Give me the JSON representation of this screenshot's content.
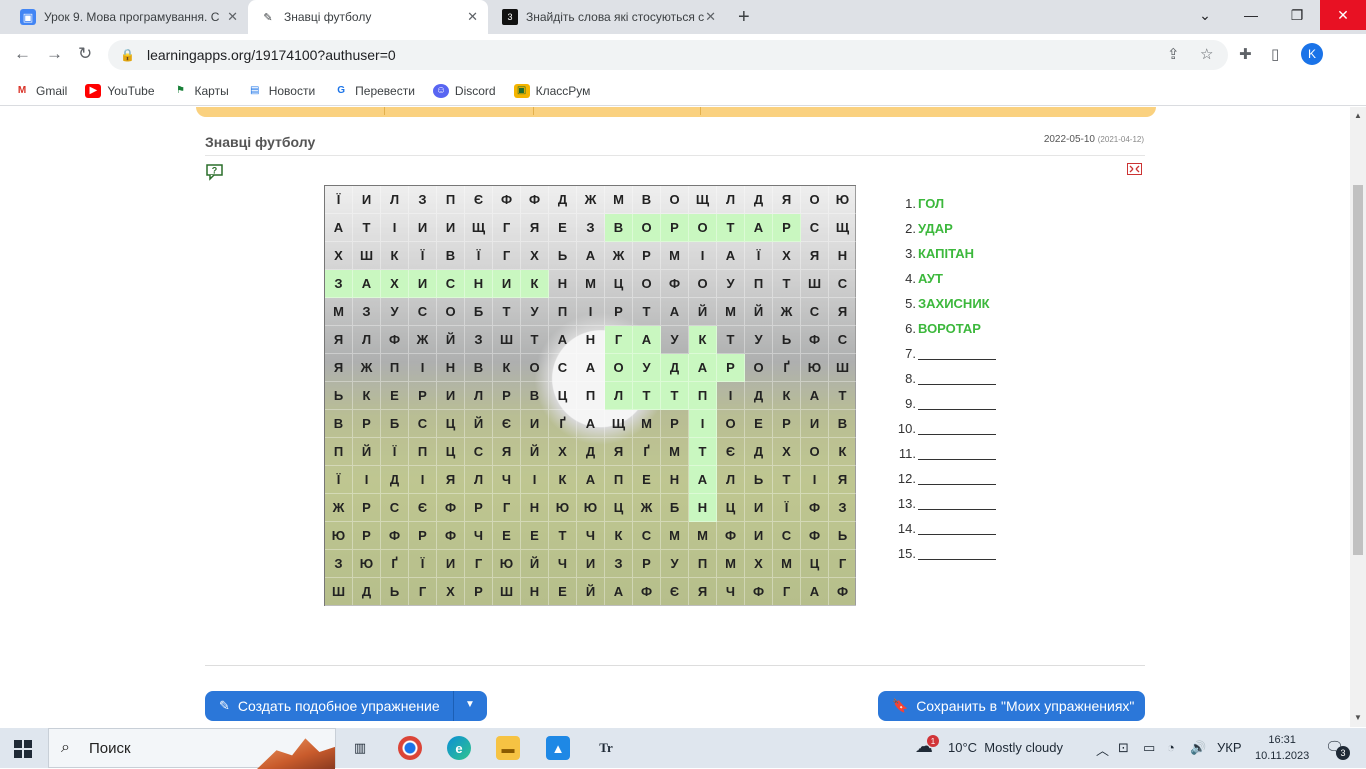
{
  "browser": {
    "tabs": [
      {
        "title": "Урок 9. Мова програмування. С",
        "active": false
      },
      {
        "title": "Знавці футболу",
        "active": true
      },
      {
        "title": "Знайдіть слова які стосуються с",
        "active": false
      }
    ],
    "url": "learningapps.org/19174100?authuser=0",
    "profile_initial": "K",
    "bookmarks": [
      "Gmail",
      "YouTube",
      "Карты",
      "Новости",
      "Перевести",
      "Discord",
      "КлассРум"
    ]
  },
  "app": {
    "title": "Знавці футболу",
    "date": "2022-05-10",
    "date_small": "(2021-04-12)"
  },
  "grid_rows": [
    "ЇИЛЗПЄФФДЖМВОЩЛДЯОЮ",
    "АТІИИЩГЯЕЗВОРОТАРСЩ",
    "ХШКЇВЇГХЬАЖРМІАЇХЯН",
    "ЗАХИСНИКНМЦОФОУПТШС",
    "МЗУСОБТУПІРТАЙМЙЖСЯ",
    "ЯЛФЖЙЗШТАНГАУКТУЬФС",
    "ЯЖПІНВКОСАОУДАРОҐЮШ",
    "ЬКЕРИЛРВЦПЛТТПІДКАТ",
    "ВРБСЦЙЄИҐАЩМРІОЕРИВ",
    "ПЙЇПЦСЯЙХДЯҐМТЄДХОК",
    "ЇІДІЯЛЧІКАПЕНАЛЬТІЯ",
    "ЖРСЄФРГНЮЮЦЖБНЦИЇФЗ",
    "ЮРФРФЧЕЕТЧКСММФИСФЬ",
    "ЗЮҐЇИГЮЙЧИЗРУПМХМЦГ",
    "ШДЬГХРШНЕЙАФЄЯЧФГАФ"
  ],
  "found_cells": [
    [
      1,
      10
    ],
    [
      1,
      11
    ],
    [
      1,
      12
    ],
    [
      1,
      13
    ],
    [
      1,
      14
    ],
    [
      1,
      15
    ],
    [
      1,
      16
    ],
    [
      3,
      0
    ],
    [
      3,
      1
    ],
    [
      3,
      2
    ],
    [
      3,
      3
    ],
    [
      3,
      4
    ],
    [
      3,
      5
    ],
    [
      3,
      6
    ],
    [
      3,
      7
    ],
    [
      5,
      10
    ],
    [
      5,
      11
    ],
    [
      5,
      13
    ],
    [
      6,
      10
    ],
    [
      6,
      11
    ],
    [
      6,
      12
    ],
    [
      6,
      13
    ],
    [
      6,
      14
    ],
    [
      7,
      10
    ],
    [
      7,
      11
    ],
    [
      7,
      12
    ],
    [
      7,
      13
    ],
    [
      8,
      13
    ],
    [
      9,
      13
    ],
    [
      10,
      13
    ],
    [
      11,
      13
    ]
  ],
  "words": [
    {
      "num": "1.",
      "text": "ГОЛ"
    },
    {
      "num": "2.",
      "text": "УДАР"
    },
    {
      "num": "3.",
      "text": "КАПІТАН"
    },
    {
      "num": "4.",
      "text": "АУТ"
    },
    {
      "num": "5.",
      "text": "ЗАХИСНИК"
    },
    {
      "num": "6.",
      "text": "ВОРОТАР"
    },
    {
      "num": "7.",
      "text": ""
    },
    {
      "num": "8.",
      "text": ""
    },
    {
      "num": "9.",
      "text": ""
    },
    {
      "num": "10.",
      "text": ""
    },
    {
      "num": "11.",
      "text": ""
    },
    {
      "num": "12.",
      "text": ""
    },
    {
      "num": "13.",
      "text": ""
    },
    {
      "num": "14.",
      "text": ""
    },
    {
      "num": "15.",
      "text": ""
    }
  ],
  "buttons": {
    "create": "Создать подобное упражнение",
    "save": "Сохранить в \"Моих упражнениях\""
  },
  "taskbar": {
    "search": "Поиск",
    "weather": "10°C  Mostly cloudy",
    "weather_badge": "1",
    "lang": "УКР",
    "time": "16:31",
    "date": "10.11.2023",
    "notifications": "3"
  },
  "colors": {
    "accent": "#2b77d9",
    "found_word": "#3cb83c",
    "found_cell": "#c9f7c0",
    "orange_bar": "#fad17f"
  }
}
